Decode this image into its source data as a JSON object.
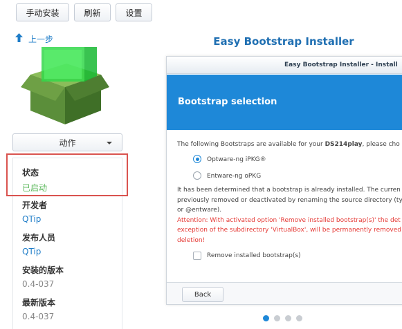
{
  "toolbar": {
    "manual_install": "手动安装",
    "refresh": "刷新",
    "settings": "设置"
  },
  "sidebar": {
    "back_label": "上一步",
    "action_label": "动作",
    "status_label": "状态",
    "status_value": "已启动",
    "developer_label": "开发者",
    "developer_value": "QTip",
    "publisher_label": "发布人员",
    "publisher_value": "QTip",
    "installed_version_label": "安装的版本",
    "installed_version_value": "0.4-037",
    "latest_version_label": "最新版本",
    "latest_version_value": "0.4-037"
  },
  "main": {
    "title": "Easy Bootstrap Installer",
    "dialog_title": "Easy Bootstrap Installer - Install",
    "banner": "Bootstrap selection",
    "intro_prefix": "The following Bootstraps are available for your ",
    "intro_device": "DS214play",
    "intro_suffix": ", please cho",
    "option1": "Optware-ng iPKG®",
    "option2": "Entware-ng oPKG",
    "note_line1": "It has been determined that a bootstrap is already installed. The curren",
    "note_line2": "previously removed or deactivated by renaming the source directory (ty",
    "note_line3": "or @entware).",
    "warn_line1": "Attention: With activated option 'Remove installed bootstrap(s)' the det",
    "warn_line2": "exception of the subdirectory 'VirtualBox', will be permanently removed",
    "warn_line3": "deletion!",
    "remove_checkbox_label": "Remove installed bootstrap(s)",
    "back_button": "Back"
  },
  "colors": {
    "accent": "#1e88d8",
    "status_green": "#5cb85c",
    "link_blue": "#1f7dc8",
    "highlight_red": "#d9534f",
    "warning_red": "#e53935"
  },
  "pagination": {
    "pages": 4,
    "current": 1
  }
}
